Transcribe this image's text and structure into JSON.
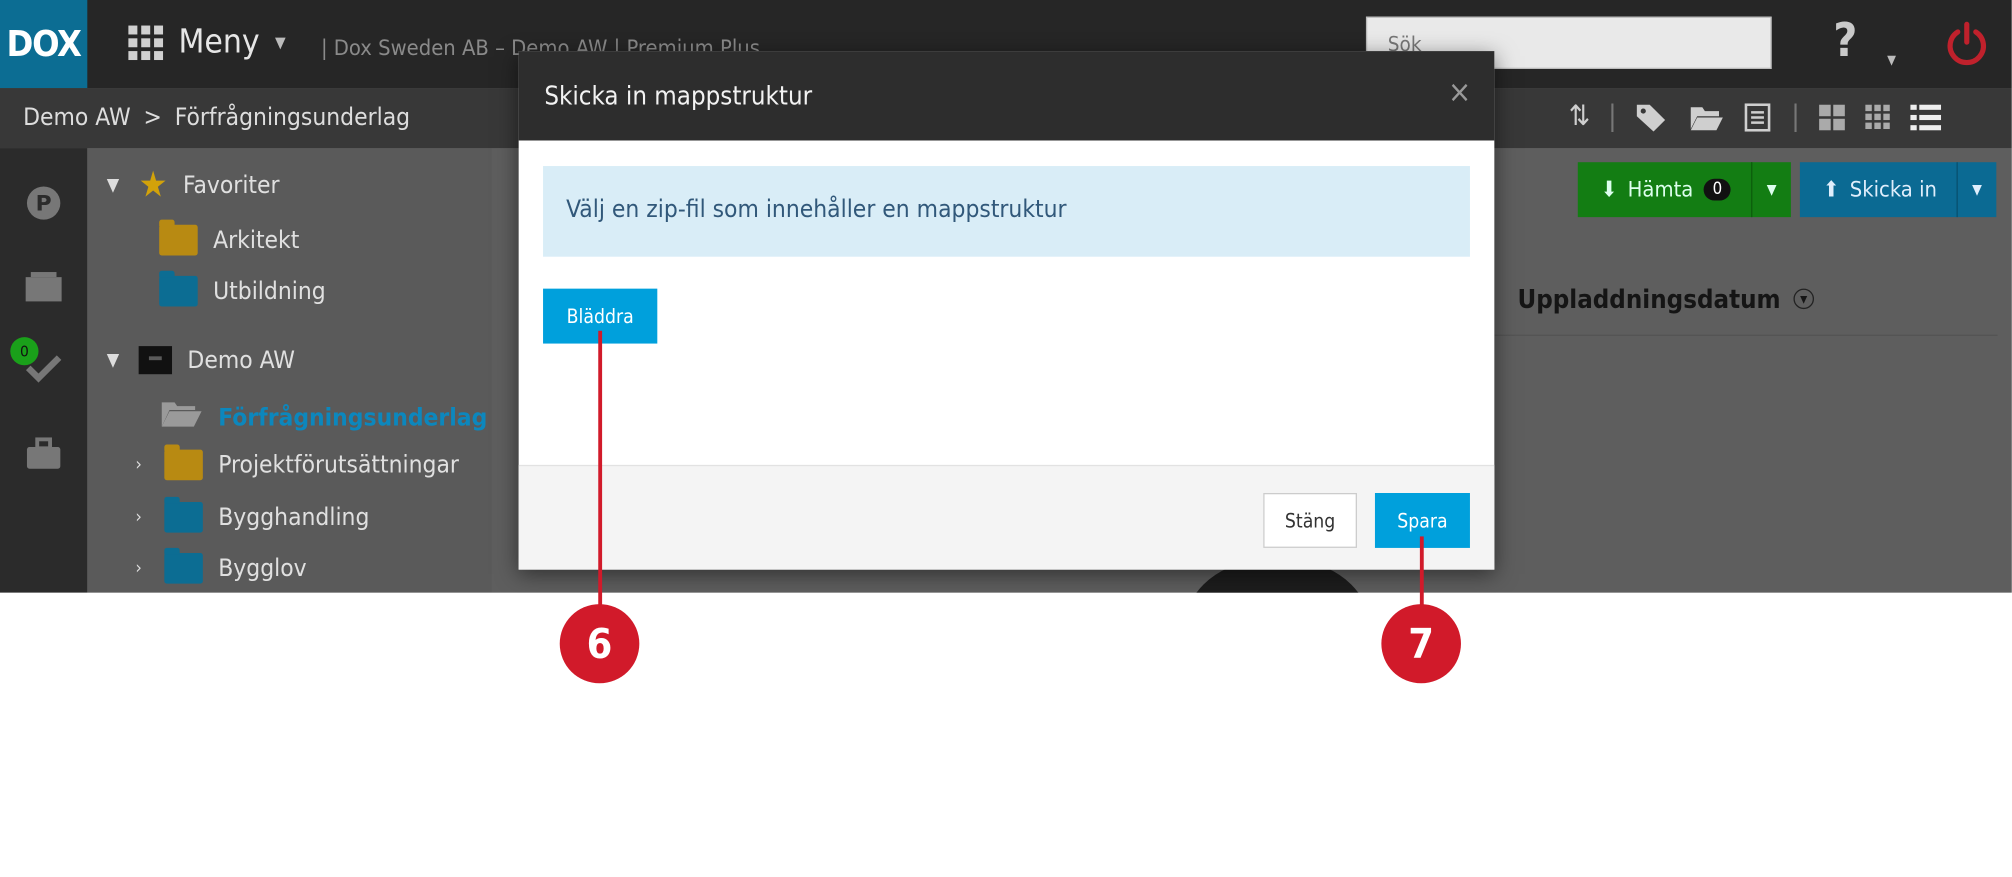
{
  "app": {
    "logo": "DOX",
    "menu_label": "Meny",
    "company": "| Dox Sweden AB – Demo AW | Premium Plus"
  },
  "search": {
    "placeholder": "Sök"
  },
  "breadcrumb": {
    "root": "Demo AW",
    "separator": ">",
    "current": "Förfrågningsunderlag"
  },
  "sidebar": {
    "badge": "0"
  },
  "tree": {
    "favorites_label": "Favoriter",
    "favorites": [
      "Arkitekt",
      "Utbildning"
    ],
    "project_label": "Demo AW",
    "folders": [
      "Förfrågningsunderlag",
      "Projektförutsättningar",
      "Bygghandling",
      "Bygglov"
    ]
  },
  "toolbar": {
    "download_label": "Hämta",
    "download_count": "0",
    "upload_label": "Skicka in"
  },
  "table": {
    "column_upload_date": "Uppladdningsdatum"
  },
  "modal": {
    "title": "Skicka in mappstruktur",
    "close_x": "×",
    "info_text": "Välj en zip-fil som innehåller en mappstruktur",
    "browse_label": "Bläddra",
    "close_label": "Stäng",
    "save_label": "Spara"
  },
  "callouts": [
    "6",
    "7"
  ],
  "colors": {
    "accent": "#00a0dc",
    "callout": "#d11a2a",
    "info_bg": "#d9edf7",
    "green": "#1aa01a"
  }
}
